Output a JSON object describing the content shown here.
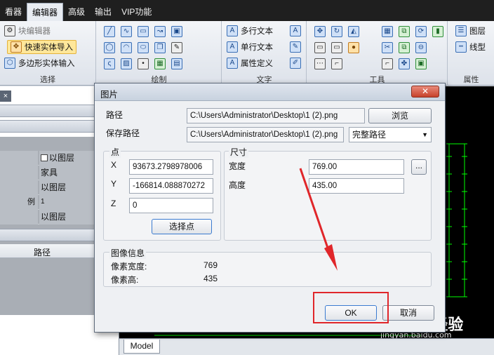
{
  "menubar": {
    "items": [
      "看器",
      "编辑器",
      "高级",
      "输出",
      "VIP功能"
    ],
    "active_index": 1
  },
  "ribbon": {
    "select_group": {
      "items": [
        "块编辑器",
        "快速实体导入",
        "多边形实体输入"
      ],
      "label": "选择"
    },
    "draw_group": {
      "label": "绘制"
    },
    "text_group": {
      "items": [
        "多行文本",
        "单行文本",
        "属性定义"
      ],
      "label": "文字"
    },
    "tools_group": {
      "label": "工具"
    },
    "properties_group": {
      "items": [
        "图层",
        "线型"
      ],
      "label": "属性"
    }
  },
  "left_panel": {
    "close_glyph": "×",
    "properties": [
      {
        "key": "",
        "value": "以图层",
        "checkbox": true
      },
      {
        "key": "",
        "value": "家具"
      },
      {
        "key": "",
        "value": "以图层"
      },
      {
        "key": "例",
        "value": "1"
      },
      {
        "key": "",
        "value": "以图层"
      }
    ],
    "path_header": "路径"
  },
  "cad": {
    "model_tab": "Model",
    "watermark_main": "Baidu 经验",
    "watermark_sub": "jingyan.baidu.com"
  },
  "dialog": {
    "title": "图片",
    "close_glyph": "✕",
    "path_label": "路径",
    "path_value": "C:\\Users\\Administrator\\Desktop\\1 (2).png",
    "browse_button": "浏览",
    "save_path_label": "保存路径",
    "save_path_value": "C:\\Users\\Administrator\\Desktop\\1 (2).png",
    "save_path_mode": "完整路径",
    "point_group": {
      "title": "点",
      "x_label": "X",
      "x_value": "93673.2798978006",
      "y_label": "Y",
      "y_value": "-166814.088870272",
      "z_label": "Z",
      "z_value": "0",
      "select_button": "选择点"
    },
    "size_group": {
      "title": "尺寸",
      "width_label": "宽度",
      "width_value": "769.00",
      "height_label": "高度",
      "height_value": "435.00",
      "more_button": "..."
    },
    "image_info": {
      "title": "图像信息",
      "pixel_width_label": "像素宽度:",
      "pixel_width_value": "769",
      "pixel_height_label": "像素高:",
      "pixel_height_value": "435"
    },
    "ok_button": "OK",
    "cancel_button": "取消"
  },
  "colors": {
    "annotation_red": "#e0262a",
    "menubar_bg": "#1f1f1f",
    "cad_bg": "#000000",
    "cad_lines": "#00ff00"
  }
}
